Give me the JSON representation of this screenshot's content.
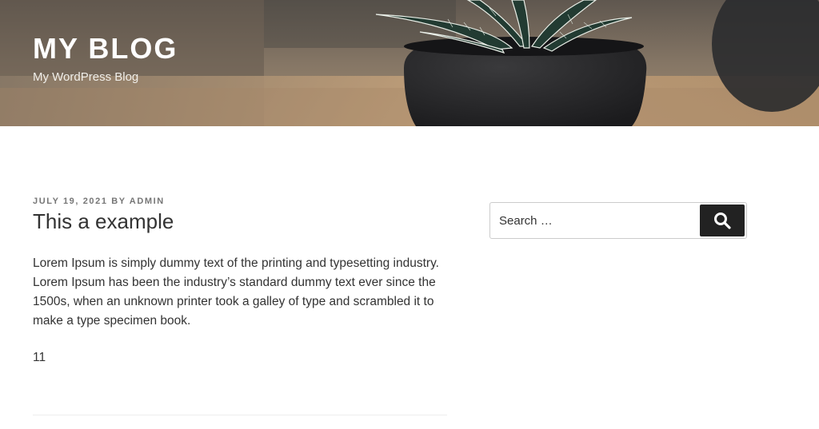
{
  "site": {
    "title": "MY BLOG",
    "description": "My WordPress Blog"
  },
  "post": {
    "meta_date": "JULY 19, 2021",
    "meta_by": "BY",
    "meta_author": "ADMIN",
    "title": "This a example",
    "body": "Lorem Ipsum is simply dummy text of the printing and typesetting industry. Lorem Ipsum has been the industry’s standard dummy text ever since the 1500s, when an unknown printer took a galley of type and scrambled it to make a type specimen book.",
    "extra": "11"
  },
  "sidebar": {
    "search": {
      "placeholder": "Search …",
      "button_icon": "search-icon"
    }
  },
  "colors": {
    "search_button": "#222222",
    "meta_text": "#767676"
  }
}
